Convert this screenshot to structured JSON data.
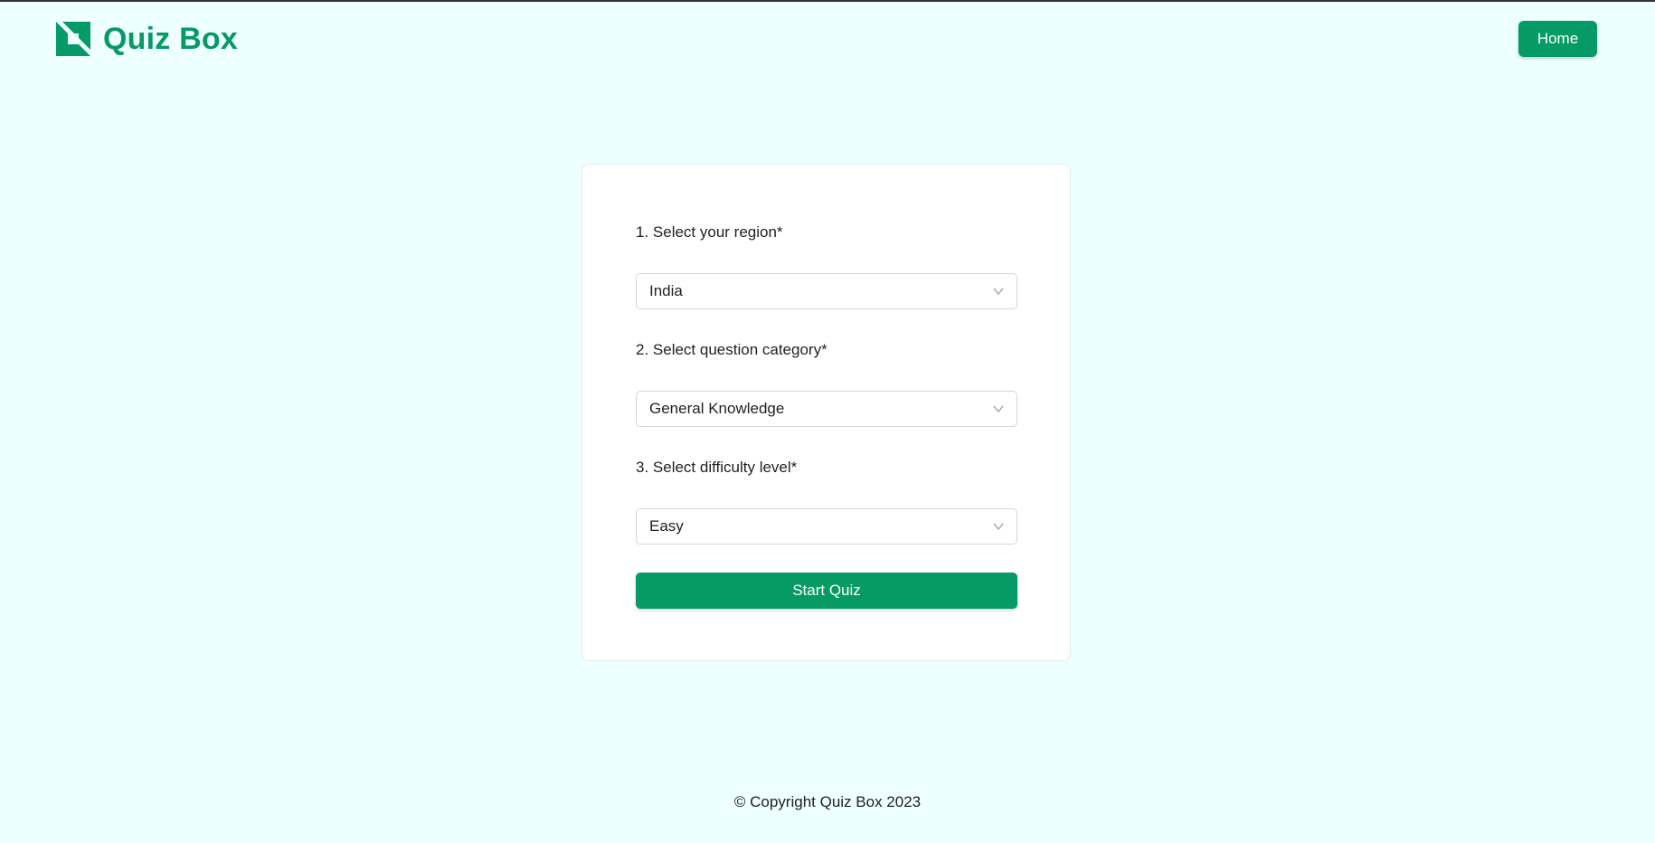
{
  "header": {
    "brand_title": "Quiz Box",
    "logo_icon": "quiz-box-logo-icon",
    "home_label": "Home"
  },
  "form": {
    "fields": [
      {
        "label": "1. Select your region*",
        "selected": "India"
      },
      {
        "label": "2. Select question category*",
        "selected": "General Knowledge"
      },
      {
        "label": "3. Select difficulty level*",
        "selected": "Easy"
      }
    ],
    "submit_label": "Start Quiz"
  },
  "footer": {
    "copyright": "© Copyright Quiz Box 2023"
  },
  "colors": {
    "background": "#edfffe",
    "brand": "#069a66",
    "card": "#ffffff"
  }
}
